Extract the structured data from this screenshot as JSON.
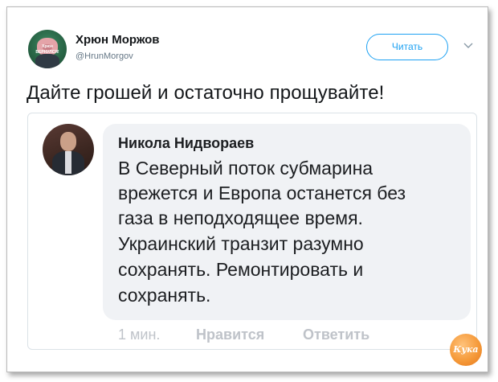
{
  "tweet": {
    "author": {
      "display_name": "Хрюн Моржов",
      "handle": "@HrunMorgov",
      "avatar_caption": "Хрюн ВЕРНУЛСЯ!"
    },
    "follow_label": "Читать",
    "text": "Дайте грошей и остаточно прощувайте!"
  },
  "embedded_comment": {
    "author": "Никола Нидвораев",
    "lines": [
      "В Северный поток субмарина",
      "врежется и Европа останется без",
      "газа в неподходящее время.",
      "Украинский транзит разумно",
      "сохранять. Ремонтировать и",
      "сохранять."
    ],
    "time": "1 мин.",
    "like_label": "Нравится",
    "reply_label": "Ответить"
  },
  "watermark_text": "Кука",
  "colors": {
    "accent": "#1da1f2",
    "bubble": "#f0f2f5",
    "watermark": "#f59a3a"
  },
  "icons": {
    "menu": "chevron-down-icon"
  }
}
